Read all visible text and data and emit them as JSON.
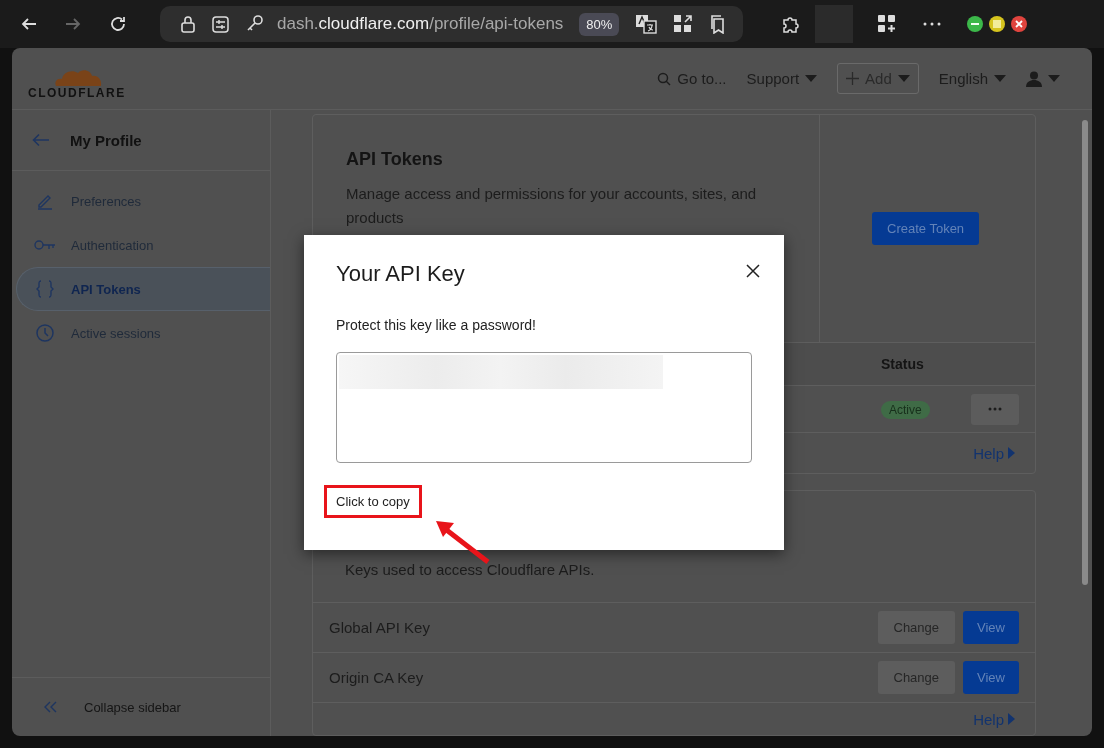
{
  "browser": {
    "forward": {
      "disabled": true
    },
    "url": "dash.**cloudflare.com**/profile/api-tokens",
    "zoom": "80%"
  },
  "header": {
    "logo": "CLOUDFLARE",
    "nav": [
      {
        "kind": "search",
        "label": "Go to..."
      },
      {
        "kind": "menu",
        "label": "Support"
      },
      {
        "kind": "add",
        "label": "Add"
      },
      {
        "kind": "menu",
        "label": "English"
      },
      {
        "kind": "user"
      }
    ]
  },
  "sidebar": {
    "title": "My Profile",
    "items": [
      {
        "kind": "pencil",
        "label": "Preferences",
        "selected": false
      },
      {
        "kind": "key",
        "label": "Authentication",
        "selected": false
      },
      {
        "kind": "braces",
        "label": "API Tokens",
        "selected": true
      },
      {
        "kind": "clock",
        "label": "Active sessions",
        "selected": false
      }
    ],
    "collapse": "Collapse sidebar"
  },
  "api_tokens": {
    "title": "API Tokens",
    "description": "Manage access and permissions for your accounts, sites, and products",
    "create_button": "Create Token",
    "columns": [
      "Status"
    ],
    "rows": [
      {
        "status": "Active"
      }
    ],
    "help": "Help"
  },
  "api_keys": {
    "description": "Keys used to access Cloudflare APIs.",
    "rows": [
      {
        "name": "Global API Key",
        "buttons": [
          "Change",
          "View"
        ]
      },
      {
        "name": "Origin CA Key",
        "buttons": [
          "Change",
          "View"
        ]
      }
    ],
    "help": "Help"
  },
  "modal": {
    "title": "Your API Key",
    "message": "Protect this key like a password!",
    "key_field": {
      "redacted": true
    },
    "copy_link": "Click to copy"
  },
  "annotation": {
    "highlight": true,
    "arrow": true
  }
}
